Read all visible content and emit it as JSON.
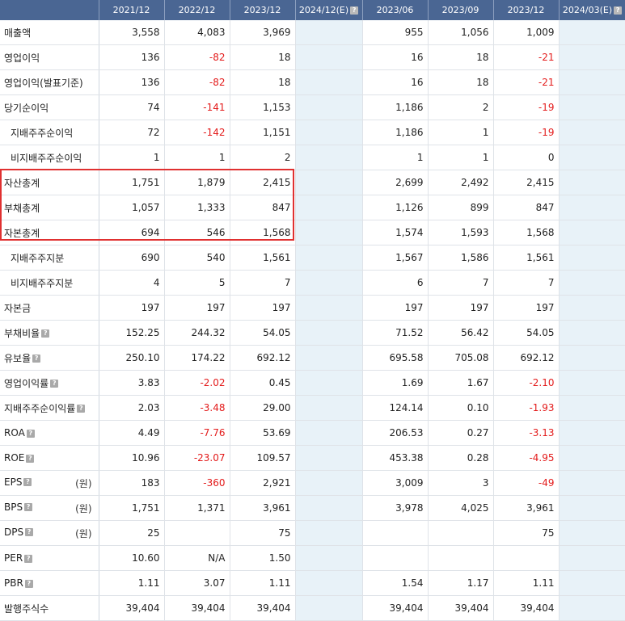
{
  "headers": [
    "",
    "2021/12",
    "2022/12",
    "2023/12",
    "2024/12(E)",
    "2023/06",
    "2023/09",
    "2023/12",
    "2024/03(E)"
  ],
  "est_columns": [
    4,
    8
  ],
  "highlight_color": "#e03030",
  "negative_color": "#e31b1b",
  "rows": [
    {
      "label": "매출액",
      "indent": false,
      "help": false,
      "unit": "",
      "values": [
        "3,558",
        "4,083",
        "3,969",
        "",
        "955",
        "1,056",
        "1,009",
        ""
      ]
    },
    {
      "label": "영업이익",
      "indent": false,
      "help": false,
      "unit": "",
      "values": [
        "136",
        "-82",
        "18",
        "",
        "16",
        "18",
        "-21",
        ""
      ]
    },
    {
      "label": "영업이익(발표기준)",
      "indent": false,
      "help": false,
      "unit": "",
      "values": [
        "136",
        "-82",
        "18",
        "",
        "16",
        "18",
        "-21",
        ""
      ]
    },
    {
      "label": "당기순이익",
      "indent": false,
      "help": false,
      "unit": "",
      "values": [
        "74",
        "-141",
        "1,153",
        "",
        "1,186",
        "2",
        "-19",
        ""
      ]
    },
    {
      "label": "지배주주순이익",
      "indent": true,
      "help": false,
      "unit": "",
      "values": [
        "72",
        "-142",
        "1,151",
        "",
        "1,186",
        "1",
        "-19",
        ""
      ]
    },
    {
      "label": "비지배주주순이익",
      "indent": true,
      "help": false,
      "unit": "",
      "values": [
        "1",
        "1",
        "2",
        "",
        "1",
        "1",
        "0",
        ""
      ]
    },
    {
      "label": "자산총계",
      "indent": false,
      "help": false,
      "unit": "",
      "values": [
        "1,751",
        "1,879",
        "2,415",
        "",
        "2,699",
        "2,492",
        "2,415",
        ""
      ]
    },
    {
      "label": "부채총계",
      "indent": false,
      "help": false,
      "unit": "",
      "values": [
        "1,057",
        "1,333",
        "847",
        "",
        "1,126",
        "899",
        "847",
        ""
      ]
    },
    {
      "label": "자본총계",
      "indent": false,
      "help": false,
      "unit": "",
      "values": [
        "694",
        "546",
        "1,568",
        "",
        "1,574",
        "1,593",
        "1,568",
        ""
      ]
    },
    {
      "label": "지배주주지분",
      "indent": true,
      "help": false,
      "unit": "",
      "values": [
        "690",
        "540",
        "1,561",
        "",
        "1,567",
        "1,586",
        "1,561",
        ""
      ]
    },
    {
      "label": "비지배주주지분",
      "indent": true,
      "help": false,
      "unit": "",
      "values": [
        "4",
        "5",
        "7",
        "",
        "6",
        "7",
        "7",
        ""
      ]
    },
    {
      "label": "자본금",
      "indent": false,
      "help": false,
      "unit": "",
      "values": [
        "197",
        "197",
        "197",
        "",
        "197",
        "197",
        "197",
        ""
      ]
    },
    {
      "label": "부채비율",
      "indent": false,
      "help": true,
      "unit": "",
      "values": [
        "152.25",
        "244.32",
        "54.05",
        "",
        "71.52",
        "56.42",
        "54.05",
        ""
      ]
    },
    {
      "label": "유보율",
      "indent": false,
      "help": true,
      "unit": "",
      "values": [
        "250.10",
        "174.22",
        "692.12",
        "",
        "695.58",
        "705.08",
        "692.12",
        ""
      ]
    },
    {
      "label": "영업이익률",
      "indent": false,
      "help": true,
      "unit": "",
      "values": [
        "3.83",
        "-2.02",
        "0.45",
        "",
        "1.69",
        "1.67",
        "-2.10",
        ""
      ]
    },
    {
      "label": "지배주주순이익률",
      "indent": false,
      "help": true,
      "unit": "",
      "values": [
        "2.03",
        "-3.48",
        "29.00",
        "",
        "124.14",
        "0.10",
        "-1.93",
        ""
      ]
    },
    {
      "label": "ROA",
      "indent": false,
      "help": true,
      "unit": "",
      "values": [
        "4.49",
        "-7.76",
        "53.69",
        "",
        "206.53",
        "0.27",
        "-3.13",
        ""
      ]
    },
    {
      "label": "ROE",
      "indent": false,
      "help": true,
      "unit": "",
      "values": [
        "10.96",
        "-23.07",
        "109.57",
        "",
        "453.38",
        "0.28",
        "-4.95",
        ""
      ]
    },
    {
      "label": "EPS",
      "indent": false,
      "help": true,
      "unit": "(원)",
      "values": [
        "183",
        "-360",
        "2,921",
        "",
        "3,009",
        "3",
        "-49",
        ""
      ]
    },
    {
      "label": "BPS",
      "indent": false,
      "help": true,
      "unit": "(원)",
      "values": [
        "1,751",
        "1,371",
        "3,961",
        "",
        "3,978",
        "4,025",
        "3,961",
        ""
      ]
    },
    {
      "label": "DPS",
      "indent": false,
      "help": true,
      "unit": "(원)",
      "values": [
        "25",
        "",
        "75",
        "",
        "",
        "",
        "75",
        ""
      ]
    },
    {
      "label": "PER",
      "indent": false,
      "help": true,
      "unit": "",
      "values": [
        "10.60",
        "N/A",
        "1.50",
        "",
        "",
        "",
        "",
        ""
      ]
    },
    {
      "label": "PBR",
      "indent": false,
      "help": true,
      "unit": "",
      "values": [
        "1.11",
        "3.07",
        "1.11",
        "",
        "1.54",
        "1.17",
        "1.11",
        ""
      ]
    },
    {
      "label": "발행주식수",
      "indent": false,
      "help": false,
      "unit": "",
      "values": [
        "39,404",
        "39,404",
        "39,404",
        "",
        "39,404",
        "39,404",
        "39,404",
        ""
      ]
    }
  ]
}
